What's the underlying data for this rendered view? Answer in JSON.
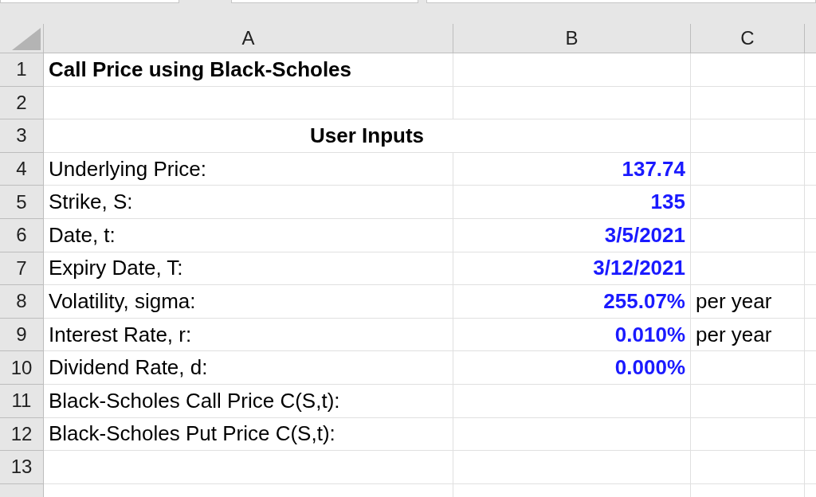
{
  "columns": [
    "A",
    "B",
    "C"
  ],
  "rows": [
    {
      "number": "1",
      "a": {
        "text": "Call Price using Black-Scholes",
        "kind": "title"
      }
    },
    {
      "number": "2"
    },
    {
      "number": "3",
      "a": {
        "text": "User Inputs",
        "kind": "heading"
      }
    },
    {
      "number": "4",
      "a": {
        "text": "Underlying Price:",
        "kind": "label"
      },
      "b": {
        "text": "137.74",
        "kind": "input"
      }
    },
    {
      "number": "5",
      "a": {
        "text": "Strike, S:",
        "kind": "label"
      },
      "b": {
        "text": "135",
        "kind": "input"
      }
    },
    {
      "number": "6",
      "a": {
        "text": "Date, t:",
        "kind": "label"
      },
      "b": {
        "text": "3/5/2021",
        "kind": "input"
      }
    },
    {
      "number": "7",
      "a": {
        "text": "Expiry Date, T:",
        "kind": "label"
      },
      "b": {
        "text": "3/12/2021",
        "kind": "input"
      }
    },
    {
      "number": "8",
      "a": {
        "text": "Volatility, sigma:",
        "kind": "label"
      },
      "b": {
        "text": "255.07%",
        "kind": "input"
      },
      "c": {
        "text": "per year",
        "kind": "label"
      }
    },
    {
      "number": "9",
      "a": {
        "text": "Interest Rate, r:",
        "kind": "label"
      },
      "b": {
        "text": "0.010%",
        "kind": "input"
      },
      "c": {
        "text": "per year",
        "kind": "label"
      }
    },
    {
      "number": "10",
      "a": {
        "text": "Dividend Rate, d:",
        "kind": "label"
      },
      "b": {
        "text": "0.000%",
        "kind": "input"
      }
    },
    {
      "number": "11",
      "a": {
        "text": "Black-Scholes Call Price C(S,t):",
        "kind": "label"
      }
    },
    {
      "number": "12",
      "a": {
        "text": "Black-Scholes Put Price C(S,t):",
        "kind": "label"
      }
    },
    {
      "number": "13"
    }
  ]
}
